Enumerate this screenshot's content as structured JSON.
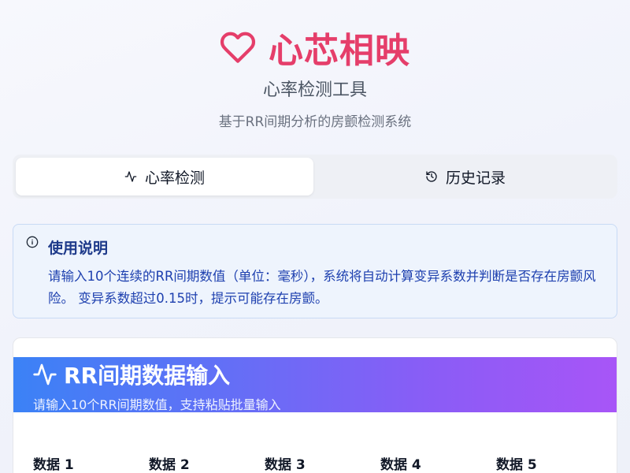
{
  "brand": {
    "title": "心芯相映",
    "icon": "heart-icon",
    "color": "#e53e6a"
  },
  "header": {
    "subtitle": "心率检测工具",
    "tagline": "基于RR间期分析的房颤检测系统"
  },
  "tabs": [
    {
      "label": "心率检测",
      "icon": "activity-icon",
      "active": true
    },
    {
      "label": "历史记录",
      "icon": "history-icon",
      "active": false
    }
  ],
  "info": {
    "title": "使用说明",
    "body": "请输入10个连续的RR间期数值（单位：毫秒），系统将自动计算变异系数并判断是否存在房颤风险。 变异系数超过0.15时，提示可能存在房颤。",
    "icon": "info-icon"
  },
  "card": {
    "title": "RR间期数据输入",
    "description": "请输入10个RR间期数值，支持粘贴批量输入",
    "icon": "activity-icon",
    "gradient": [
      "#3b82f6",
      "#a855f7"
    ]
  },
  "fields": [
    {
      "label": "数据 1"
    },
    {
      "label": "数据 2"
    },
    {
      "label": "数据 3"
    },
    {
      "label": "数据 4"
    },
    {
      "label": "数据 5"
    }
  ]
}
